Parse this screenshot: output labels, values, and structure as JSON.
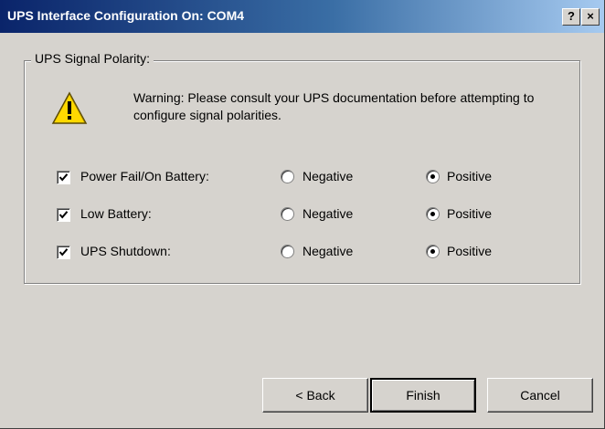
{
  "window": {
    "title": "UPS Interface Configuration On: COM4",
    "help_label": "?",
    "close_label": "×"
  },
  "group": {
    "label": "UPS Signal Polarity:",
    "warning": "Warning: Please consult your UPS documentation before attempting to configure signal polarities.",
    "warning_icon": "warning-triangle-icon"
  },
  "signals": [
    {
      "label": "Power Fail/On Battery:",
      "checked": true,
      "negative_label": "Negative",
      "positive_label": "Positive",
      "selected": "Positive"
    },
    {
      "label": "Low Battery:",
      "checked": true,
      "negative_label": "Negative",
      "positive_label": "Positive",
      "selected": "Positive"
    },
    {
      "label": "UPS Shutdown:",
      "checked": true,
      "negative_label": "Negative",
      "positive_label": "Positive",
      "selected": "Positive"
    }
  ],
  "buttons": {
    "back": "< Back",
    "finish": "Finish",
    "cancel": "Cancel"
  },
  "colors": {
    "title_start": "#0a246a",
    "title_end": "#a6caf0",
    "face": "#d6d3ce",
    "warning_yellow": "#ffd800"
  }
}
